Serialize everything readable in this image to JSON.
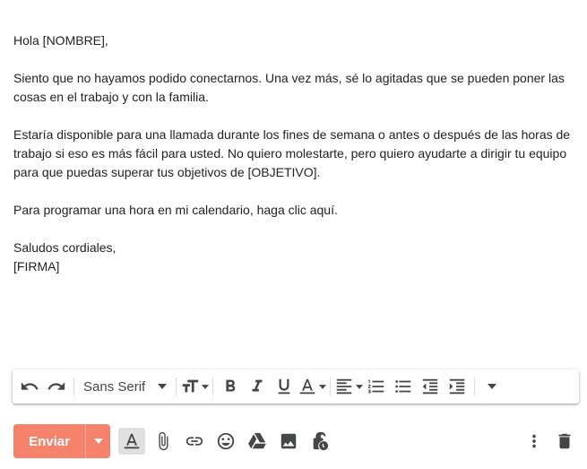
{
  "message": {
    "greeting": "Hola [NOMBRE],",
    "paragraph1": "Siento que no hayamos podido conectarnos. Una vez más, sé lo agitadas que se pueden poner las cosas en el trabajo y con la familia.",
    "paragraph2": "Estaría disponible para una llamada durante los fines de semana o antes o después de las horas de trabajo si eso es más fácil para usted. No quiero molestarte, pero quiero ayudarte a dirigir tu equipo para que puedas superar tus objetivos de [OBJETIVO].",
    "paragraph3": "Para programar una hora en mi calendario, haga clic aquí.",
    "closing": "Saludos cordiales,",
    "signature": "[FIRMA]"
  },
  "toolbar": {
    "font_family": "Sans Serif",
    "icons": [
      "undo-icon",
      "redo-icon",
      "font-size-icon",
      "bold-icon",
      "italic-icon",
      "underline-icon",
      "text-color-icon",
      "align-icon",
      "numbered-list-icon",
      "bulleted-list-icon",
      "indent-less-icon",
      "indent-more-icon",
      "more-formatting-icon"
    ]
  },
  "actions": {
    "send_label": "Enviar",
    "icons": [
      "formatting-toggle-icon",
      "attach-icon",
      "link-icon",
      "emoji-icon",
      "drive-icon",
      "photo-icon",
      "confidential-icon",
      "more-options-icon",
      "trash-icon"
    ]
  },
  "colors": {
    "send_button": "#f5826b",
    "icon": "#444746",
    "text": "#222222"
  }
}
